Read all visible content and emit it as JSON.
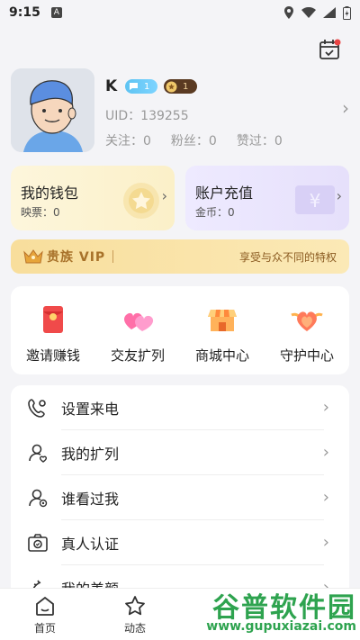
{
  "status_bar": {
    "time": "9:15",
    "a_badge": "A"
  },
  "profile": {
    "name": "K",
    "badge_level_1": "1",
    "badge_level_2": "1",
    "uid": "UID：139255",
    "stats": [
      "关注：0",
      "粉丝：0",
      "赞过：0"
    ]
  },
  "cards": {
    "wallet": {
      "title": "我的钱包",
      "sub": "映票：0"
    },
    "recharge": {
      "title": "账户充值",
      "sub": "金币：0"
    }
  },
  "vip": {
    "title": "贵族 VIP",
    "desc": "享受与众不同的特权"
  },
  "grid": [
    {
      "label": "邀请赚钱",
      "icon": "red-envelope-icon"
    },
    {
      "label": "交友扩列",
      "icon": "hearts-icon"
    },
    {
      "label": "商城中心",
      "icon": "shop-icon"
    },
    {
      "label": "守护中心",
      "icon": "guard-heart-icon"
    }
  ],
  "menu": [
    {
      "label": "设置来电",
      "icon": "phone-gear-icon"
    },
    {
      "label": "我的扩列",
      "icon": "user-heart-icon"
    },
    {
      "label": "谁看过我",
      "icon": "user-eye-icon"
    },
    {
      "label": "真人认证",
      "icon": "camera-icon"
    },
    {
      "label": "我的美颜",
      "icon": "beauty-icon"
    }
  ],
  "tabs": [
    {
      "label": "首页",
      "icon": "home-icon"
    },
    {
      "label": "动态",
      "icon": "star-icon"
    }
  ],
  "watermark": {
    "top": "谷普软件园",
    "bottom": "www.gupuxiazai.com"
  },
  "colors": {
    "accent_gold": "#a8722a",
    "wallet_bg": "#fbf0c8",
    "recharge_bg": "#e6e0fb",
    "watermark": "#2ea34f"
  }
}
